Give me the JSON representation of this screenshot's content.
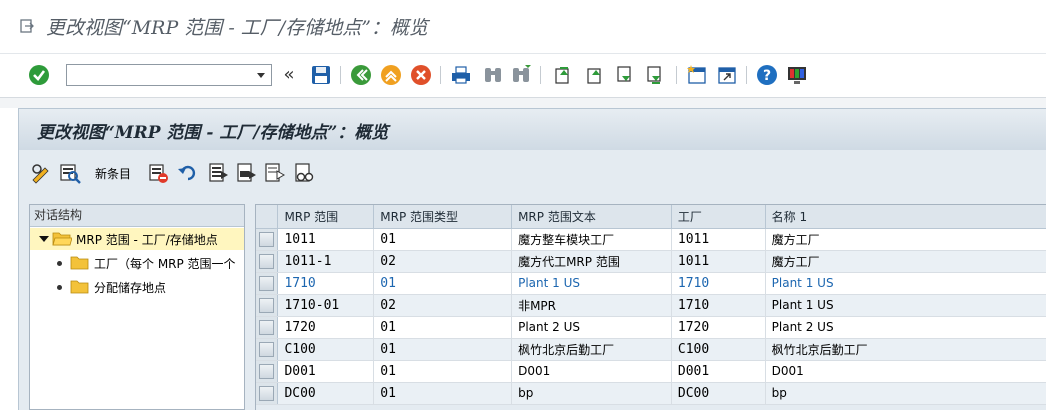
{
  "window": {
    "title": "更改视图“MRP 范围 - 工厂/存储地点”：概览"
  },
  "toolbar": {
    "command_field": {
      "value": "",
      "placeholder": ""
    },
    "icons": [
      "enter-icon",
      "save-icon",
      "back-icon",
      "exit-icon",
      "cancel-icon",
      "print-icon",
      "find-icon",
      "find-next-icon",
      "first-page-icon",
      "previous-page-icon",
      "next-page-icon",
      "last-page-icon",
      "new-session-icon",
      "shortcut-icon",
      "help-icon",
      "customize-layout-icon"
    ]
  },
  "header": {
    "title": "更改视图“MRP 范围 - 工厂/存储地点”：概览"
  },
  "app_toolbar": {
    "new_entries_label": "新条目",
    "icons": [
      "display-change-icon",
      "details-icon",
      "delete-icon",
      "undo-icon",
      "select-all-icon",
      "select-block-icon",
      "deselect-all-icon",
      "glasses-icon"
    ]
  },
  "tree": {
    "header": "对话结构",
    "items": [
      {
        "label": "MRP 范围 - 工厂/存储地点",
        "level": 0,
        "selected": true
      },
      {
        "label": "工厂（每个 MRP 范围一个",
        "level": 1,
        "selected": false
      },
      {
        "label": "分配储存地点",
        "level": 1,
        "selected": false
      }
    ]
  },
  "table": {
    "columns": [
      "MRP 范围",
      "MRP 范围类型",
      "MRP 范围文本",
      "工厂",
      "名称 1"
    ],
    "rows": [
      {
        "area": "1011",
        "type": "01",
        "text": "魔方整车模块工厂",
        "plant": "1011",
        "name": "魔方工厂",
        "highlight": false
      },
      {
        "area": "1011-1",
        "type": "02",
        "text": "魔方代工MRP 范围",
        "plant": "1011",
        "name": "魔方工厂",
        "highlight": false
      },
      {
        "area": "1710",
        "type": "01",
        "text": "Plant 1 US",
        "plant": "1710",
        "name": "Plant 1 US",
        "highlight": true
      },
      {
        "area": "1710-01",
        "type": "02",
        "text": "非MPR",
        "plant": "1710",
        "name": "Plant 1 US",
        "highlight": false
      },
      {
        "area": "1720",
        "type": "01",
        "text": "Plant 2 US",
        "plant": "1720",
        "name": "Plant 2 US",
        "highlight": false
      },
      {
        "area": "C100",
        "type": "01",
        "text": "枫竹北京后勤工厂",
        "plant": "C100",
        "name": "枫竹北京后勤工厂",
        "highlight": false
      },
      {
        "area": "D001",
        "type": "01",
        "text": "D001",
        "plant": "D001",
        "name": "D001",
        "highlight": false
      },
      {
        "area": "DC00",
        "type": "01",
        "text": "bp",
        "plant": "DC00",
        "name": "bp",
        "highlight": false
      }
    ]
  },
  "colors": {
    "highlight_text": "#1c66b0",
    "tree_selected": "#fff6bf",
    "panel_bg": "#e4ebf1"
  }
}
